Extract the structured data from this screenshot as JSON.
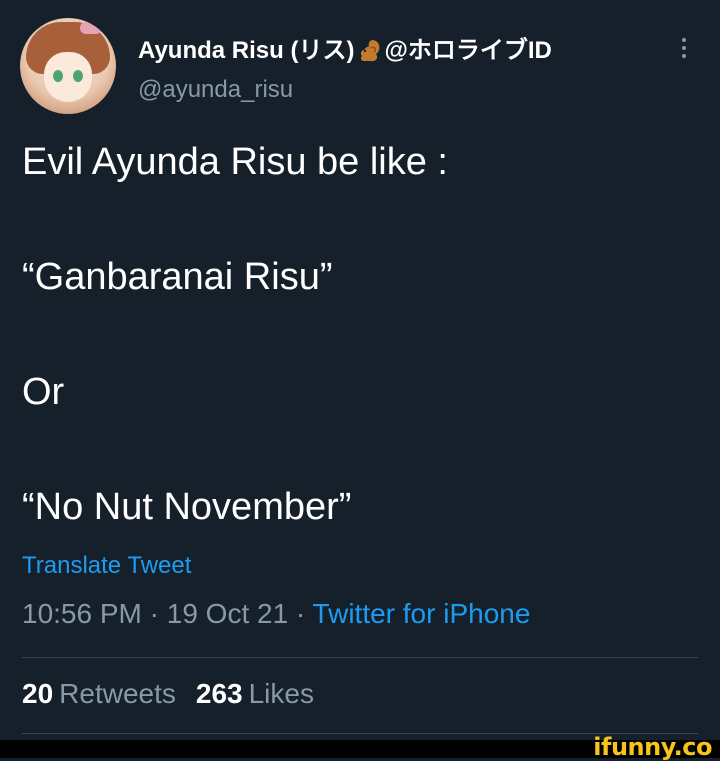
{
  "author": {
    "display_name_pre": "Ayunda Risu (リス)",
    "display_name_post": "@ホロライブID",
    "handle": "@ayunda_risu",
    "emoji_icon": "squirrel-icon"
  },
  "tweet": {
    "lines": [
      "Evil Ayunda Risu be like :",
      "“Ganbaranai Risu”",
      "Or",
      "“No Nut November”"
    ],
    "translate_label": "Translate Tweet",
    "time": "10:56 PM",
    "date": "19 Oct 21",
    "separator": " · ",
    "source": "Twitter for iPhone"
  },
  "stats": {
    "retweets_count": "20",
    "retweets_label": "Retweets",
    "likes_count": "263",
    "likes_label": "Likes"
  },
  "watermark": "ifunny.co",
  "colors": {
    "background": "#15202b",
    "text": "#ffffff",
    "secondary": "#8899a6",
    "link": "#1d9bf0",
    "divider": "#38444d",
    "watermark": "#f6c41a"
  }
}
